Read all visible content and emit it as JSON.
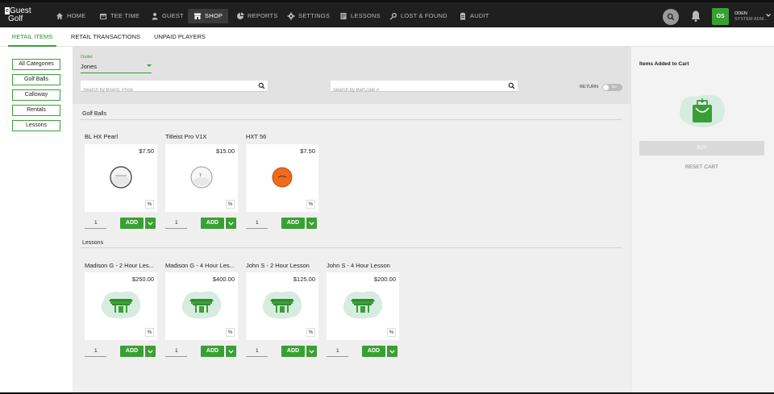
{
  "brand": {
    "line1": "Guest",
    "line2": "Golf",
    "mark": "e"
  },
  "nav": [
    {
      "label": "HOME",
      "icon": "home-icon"
    },
    {
      "label": "TEE TIME",
      "icon": "calendar-icon"
    },
    {
      "label": "GUEST",
      "icon": "guest-icon"
    },
    {
      "label": "SHOP",
      "icon": "shop-icon"
    },
    {
      "label": "REPORTS",
      "icon": "reports-icon"
    },
    {
      "label": "SETTINGS",
      "icon": "gear-icon"
    },
    {
      "label": "LESSONS",
      "icon": "lessons-icon"
    },
    {
      "label": "LOST & FOUND",
      "icon": "lost-found-icon"
    },
    {
      "label": "AUDIT",
      "icon": "audit-icon"
    }
  ],
  "user": {
    "initials": "OS",
    "name": "ODEN",
    "role": "SYSTEM ADM..."
  },
  "subtabs": [
    "RETAIL ITEMS",
    "RETAIL TRANSACTIONS",
    "UNPAID PLAYERS"
  ],
  "categories": [
    "All Categories",
    "Golf Balls",
    "Calloway",
    "Rentals",
    "Lessons"
  ],
  "filters": {
    "outlet_label": "Outlet",
    "outlet_value": "Jones",
    "search_placeholder": "Search by Brand, Price",
    "barcode_placeholder": "Search by BarCode #",
    "return_label": "RETURN",
    "return_toggle": "No"
  },
  "sections": [
    {
      "title": "Golf Balls",
      "items": [
        {
          "name": "BL HX Pearl",
          "price": "$7.50",
          "qty": "1",
          "image": "white-ball"
        },
        {
          "name": "Titleist Pro V1X",
          "price": "$15.00",
          "qty": "1",
          "image": "white-ball"
        },
        {
          "name": "HXT 56",
          "price": "$7.50",
          "qty": "1",
          "image": "orange-ball"
        }
      ]
    },
    {
      "title": "Lessons",
      "items": [
        {
          "name": "Madison G - 2 Hour Les...",
          "price": "$250.00",
          "qty": "1",
          "image": "shop-placeholder"
        },
        {
          "name": "Madison G - 4 Hour Les...",
          "price": "$400.00",
          "qty": "1",
          "image": "shop-placeholder"
        },
        {
          "name": "John S - 2 Hour Lesson",
          "price": "$125.00",
          "qty": "1",
          "image": "shop-placeholder"
        },
        {
          "name": "John S - 4 Hour Lesson",
          "price": "$200.00",
          "qty": "1",
          "image": "shop-placeholder"
        }
      ]
    }
  ],
  "card_labels": {
    "percent": "%",
    "add": "ADD"
  },
  "cart": {
    "title": "Items Added to Cart",
    "buy": "BUY",
    "reset": "RESET CART"
  },
  "colors": {
    "accent": "#3aa035",
    "topbar": "#1f1f1f",
    "main_bg": "#efefef",
    "ball_orange": "#ee6a1c"
  }
}
